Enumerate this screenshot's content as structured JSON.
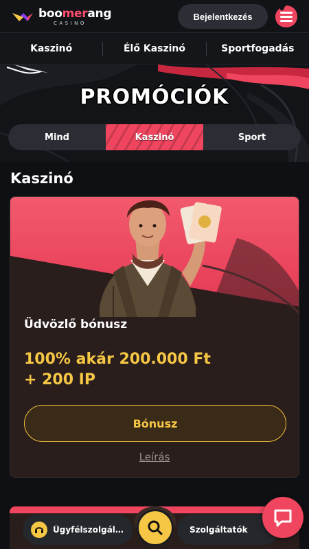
{
  "header": {
    "logo_prefix": "boo",
    "logo_accent": "mer",
    "logo_suffix": "ang",
    "logo_sub": "CASINO",
    "login_label": "Bejelentkezés",
    "menu_icon": "hamburger-menu-icon"
  },
  "nav": {
    "items": [
      {
        "label": "Kaszinó"
      },
      {
        "label": "Élő Kaszinó"
      },
      {
        "label": "Sportfogadás"
      }
    ]
  },
  "hero": {
    "title": "PROMÓCIÓK"
  },
  "filters": {
    "tabs": [
      {
        "label": "Mind",
        "active": false
      },
      {
        "label": "Kaszinó",
        "active": true
      },
      {
        "label": "Sport",
        "active": false
      }
    ]
  },
  "section": {
    "title": "Kaszinó"
  },
  "promo": {
    "title": "Üdvözlő bónusz",
    "offer_line1": "100% akár 200.000 Ft",
    "offer_line2": "+ 200 IP",
    "button_label": "Bónusz",
    "description_link": "Leírás"
  },
  "bottom_bar": {
    "support_label": "Ügyfélszolgál...",
    "providers_label": "Szolgáltatók",
    "search_icon": "search-icon",
    "chat_icon": "chat-bubble-icon"
  },
  "colors": {
    "background": "#0e1013",
    "accent_red": "#f0455f",
    "accent_yellow": "#f6c744",
    "pill": "#2a2d33"
  }
}
